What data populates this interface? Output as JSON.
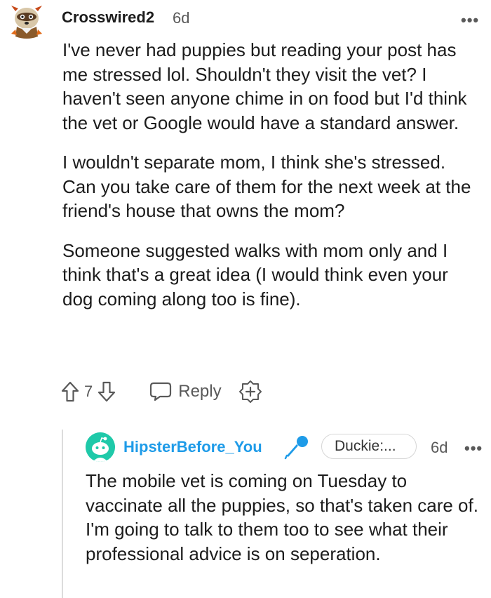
{
  "comment": {
    "author": "Crosswired2",
    "age": "6d",
    "more_label": "•••",
    "paragraphs": [
      "I've never had puppies but reading your post has me stressed lol. Shouldn't they visit the vet? I haven't seen anyone chime in on food but I'd think the vet or Google would have a standard answer.",
      "I wouldn't separate mom, I think she's stressed. Can you take care of them for the next week at the friend's house that owns the mom?",
      "Someone suggested walks with mom only and I think that's a great idea (I would think even your dog coming along too is fine)."
    ],
    "vote_count": "7",
    "reply_label": "Reply"
  },
  "reply": {
    "author": "HipsterBefore_You",
    "flair": "Duckie:...",
    "age": "6d",
    "more_label": "•••",
    "text": "The mobile vet is coming on Tuesday to vaccinate all the puppies, so that's taken care of. I'm going to talk to them too to see what their professional advice is on seperation."
  },
  "colors": {
    "username_reply": "#1e9be8",
    "avatar_reply_bg": "#1fc9a9",
    "mic_icon": "#1e9be8",
    "muted": "#595959"
  },
  "icons": [
    "raccoon-avatar-icon",
    "upvote-icon",
    "downvote-icon",
    "reply-bubble-icon",
    "add-award-icon",
    "snoo-avatar-icon",
    "microphone-icon",
    "more-options-icon"
  ]
}
